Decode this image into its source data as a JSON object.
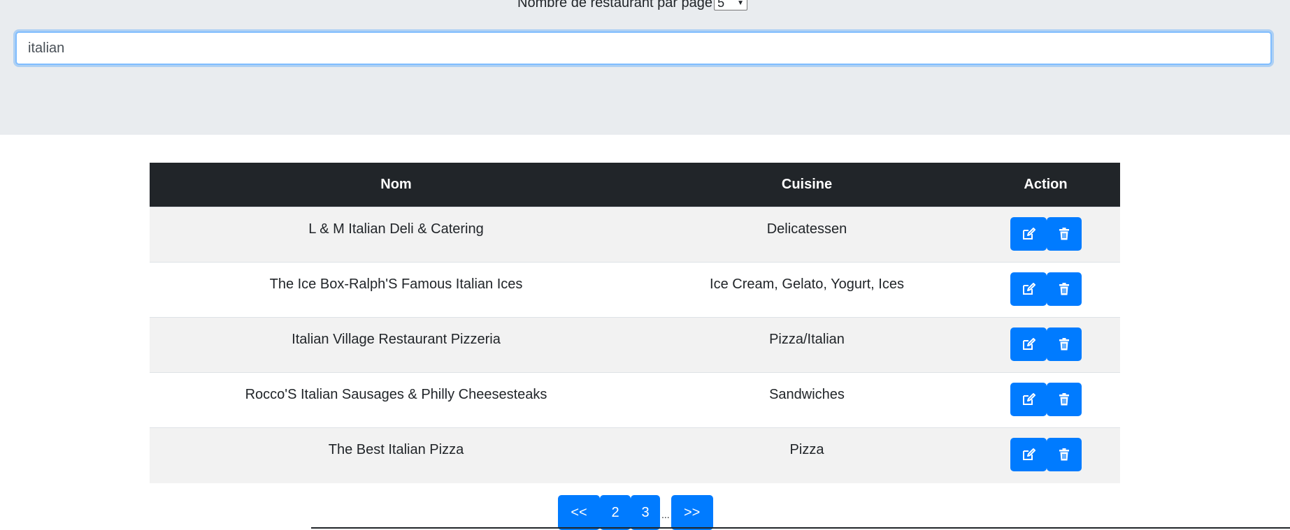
{
  "top": {
    "per_page_label": "Nombre de restaurant par page",
    "per_page_value": "5",
    "search_value": "italian"
  },
  "table": {
    "headers": [
      "Nom",
      "Cuisine",
      "Action"
    ],
    "rows": [
      {
        "nom": "L & M Italian Deli & Catering",
        "cuisine": "Delicatessen"
      },
      {
        "nom": "The Ice Box-Ralph'S Famous Italian Ices",
        "cuisine": "Ice Cream, Gelato, Yogurt, Ices"
      },
      {
        "nom": "Italian Village Restaurant Pizzeria",
        "cuisine": "Pizza/Italian"
      },
      {
        "nom": "Rocco'S Italian Sausages & Philly Cheesesteaks",
        "cuisine": "Sandwiches"
      },
      {
        "nom": "The Best Italian Pizza",
        "cuisine": "Pizza"
      }
    ],
    "edit_icon": "edit-icon",
    "delete_icon": "trash-icon"
  },
  "pagination": {
    "prev": "<<",
    "pages": [
      "2",
      "3"
    ],
    "ellipsis": "...",
    "next": ">>"
  },
  "colors": {
    "primary": "#007bff",
    "header_bg": "#212529",
    "panel_bg": "#e9ecef"
  }
}
